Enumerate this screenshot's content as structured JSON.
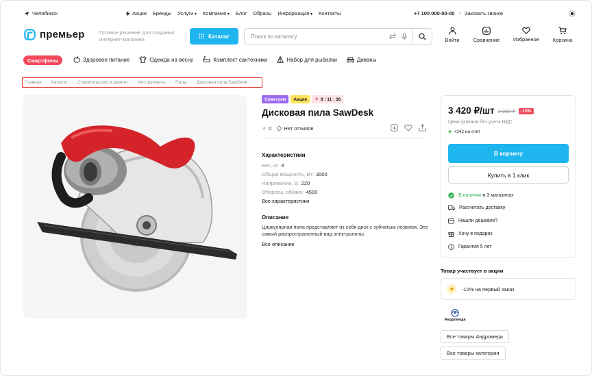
{
  "topbar": {
    "city": "Челябинск",
    "nav": [
      "Акции",
      "Бренды",
      "Услуги",
      "Компания",
      "Блог",
      "Образы",
      "Информация",
      "Контакты"
    ],
    "phone": "+7 100 000-00-00",
    "callback": "Заказать звонок"
  },
  "header": {
    "logo": "премьер",
    "tagline": "Готовое решение для создания интернет-магазина",
    "catalog": "Каталог",
    "search_placeholder": "Поиск по каталогу",
    "icons": [
      {
        "label": "Войти",
        "icon": "user-icon"
      },
      {
        "label": "Сравнение",
        "icon": "compare-icon"
      },
      {
        "label": "Избранное",
        "icon": "heart-icon"
      },
      {
        "label": "Корзина",
        "icon": "cart-icon"
      }
    ]
  },
  "quick": {
    "highlight": "Смартфоны",
    "items": [
      "Здоровое питание",
      "Одежда на весну",
      "Комплект сантехники",
      "Набор для рыбалки",
      "Диваны"
    ]
  },
  "breadcrumb": [
    "Главная",
    "Каталог",
    "Строительство и ремонт",
    "Инструменты",
    "Пилы",
    "Дисковая пила SawDesk"
  ],
  "product": {
    "badges": [
      "Советуем",
      "Акция",
      "8 : 11 : 36"
    ],
    "title": "Дисковая пила SawDesk",
    "rating": "0",
    "reviews": "Нет отзывов",
    "specs_title": "Характеристики",
    "specs": [
      {
        "k": "Вес, кг:",
        "v": "4"
      },
      {
        "k": "Общая мощность, Вт:",
        "v": "3000"
      },
      {
        "k": "Напряжение, В:",
        "v": "220"
      },
      {
        "k": "Обороты, об/мин:",
        "v": "4500"
      }
    ],
    "all_specs": "Все характеристики",
    "desc_title": "Описание",
    "desc": "Циркулярная пила представляет из себя диск с зубчатым лезвием. Это самый распространенный вид электропилы.",
    "all_desc": "Все описание"
  },
  "price": {
    "current": "3 420 ₽/шт",
    "old": "3 800 ₽",
    "discount": "-10%",
    "note": "Цена указана без учета НДС",
    "bonus": "+342 на счет",
    "buy": "В корзину",
    "one_click": "Купить в 1 клик",
    "stock_a": "В наличии",
    "stock_b": "в 3 магазинах",
    "features": [
      "Рассчитать доставку",
      "Нашли дешевле?",
      "Хочу в подарок",
      "Гарантия 5 лет"
    ]
  },
  "promo": {
    "title": "Товар участвует в акции",
    "text": "-10% на первый заказ"
  },
  "brand": {
    "name": "Андромеда",
    "all_brand": "Все товары Андромеда",
    "all_cat": "Все товары категории"
  },
  "colors": {
    "accent": "#1fb5ee",
    "sale": "#f24a5b",
    "ok": "#2bb34b"
  }
}
